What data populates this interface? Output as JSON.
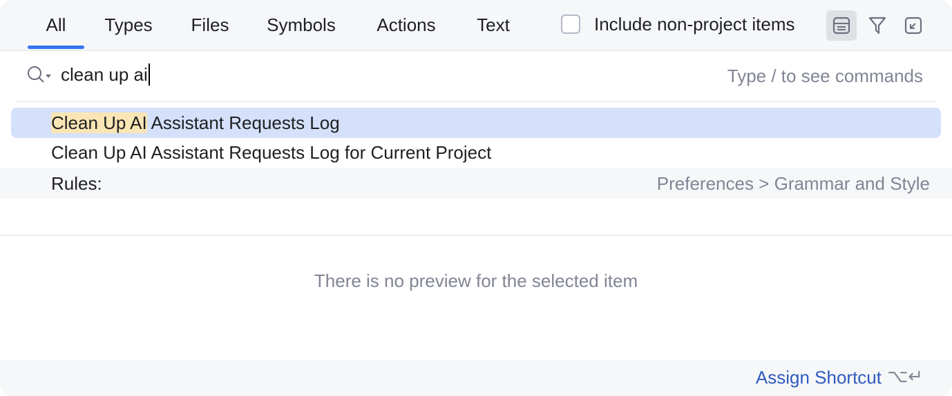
{
  "tabs": [
    {
      "label": "All",
      "active": true
    },
    {
      "label": "Types",
      "active": false
    },
    {
      "label": "Files",
      "active": false
    },
    {
      "label": "Symbols",
      "active": false
    },
    {
      "label": "Actions",
      "active": false
    },
    {
      "label": "Text",
      "active": false
    }
  ],
  "include_non_project": {
    "label": "Include non-project items",
    "checked": false
  },
  "toolbar_icons": [
    "preview-icon",
    "filter-icon",
    "collapse-icon"
  ],
  "search": {
    "value": "clean up ai",
    "hint": "Type / to see commands"
  },
  "results": [
    {
      "highlight": "Clean Up AI",
      "rest": " Assistant Requests Log",
      "selected": true
    },
    {
      "highlight": "",
      "rest": "Clean Up AI Assistant Requests Log for Current Project",
      "selected": false
    }
  ],
  "group": {
    "label": "Rules:",
    "path": "Preferences > Grammar and Style"
  },
  "preview": {
    "message": "There is no preview for the selected item"
  },
  "footer": {
    "assign_label": "Assign Shortcut",
    "shortcut": "⌥↵"
  },
  "colors": {
    "accent": "#3574f0",
    "selection": "#d5e0fa",
    "match_highlight": "#fae6b4",
    "link": "#2f5bbd"
  }
}
